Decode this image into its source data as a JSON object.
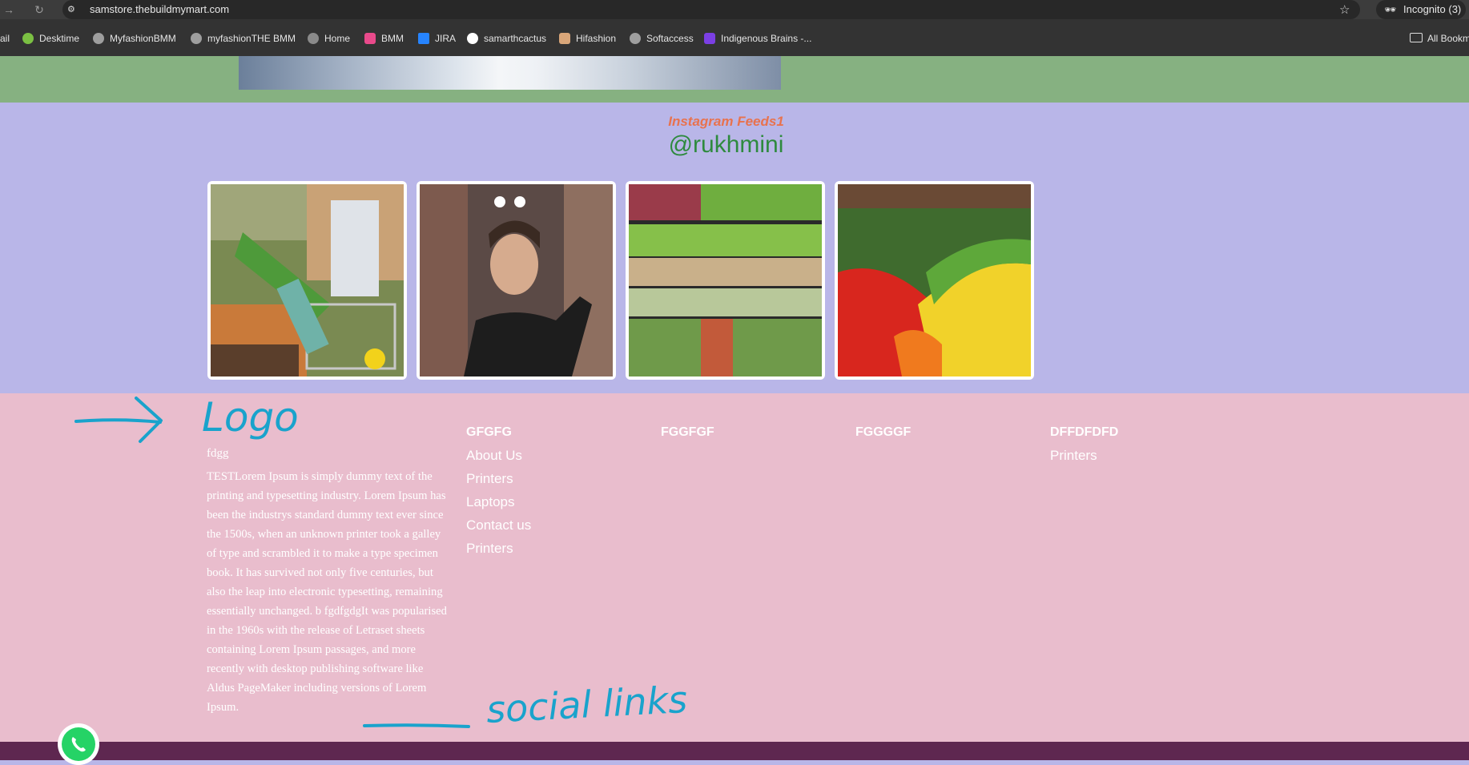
{
  "browser": {
    "url": "samstore.thebuildmymart.com",
    "incognito_label": "Incognito (3)",
    "bookmarks": [
      {
        "label": "ail",
        "color": "#3c3c3c"
      },
      {
        "label": "Desktime",
        "color": "#7bc043"
      },
      {
        "label": "MyfashionBMM",
        "color": "#9e9e9e"
      },
      {
        "label": "myfashionTHE BMM",
        "color": "#9e9e9e"
      },
      {
        "label": "Home",
        "color": "#8a8a8a"
      },
      {
        "label": "BMM",
        "color": "#e94a8b"
      },
      {
        "label": "JIRA",
        "color": "#2684ff"
      },
      {
        "label": "samarthcactus",
        "color": "#ffffff"
      },
      {
        "label": "Hifashion",
        "color": "#d9a679"
      },
      {
        "label": "Softaccess",
        "color": "#9e9e9e"
      },
      {
        "label": "Indigenous Brains -...",
        "color": "#7b3fe4"
      }
    ],
    "all_bookmarks": "All Bookmarks"
  },
  "instagram": {
    "subtitle": "Instagram Feeds1",
    "handle": "@rukhmini",
    "feeds": [
      {
        "label": "grocery basket photo"
      },
      {
        "label": "woman in supermarket photo"
      },
      {
        "label": "vegetable shelves photo"
      },
      {
        "label": "fruit display photo"
      }
    ]
  },
  "footer": {
    "logo_text": "fdgg",
    "description": "TESTLorem Ipsum is simply dummy text of the printing and typesetting industry. Lorem Ipsum has been the industrys standard dummy text ever since the 1500s, when an unknown printer took a galley of type and scrambled it to make a type specimen book. It has survived not only five centuries, but also the leap into electronic typesetting, remaining essentially unchanged. b fgdfgdgIt was popularised in the 1960s with the release of Letraset sheets containing Lorem Ipsum passages, and more recently with desktop publishing software like Aldus PageMaker including versions of Lorem Ipsum.",
    "columns": [
      {
        "heading": "GFGFG",
        "links": [
          "About Us",
          "Printers",
          "Laptops",
          "Contact us",
          "Printers"
        ]
      },
      {
        "heading": "FGGFGF",
        "links": []
      },
      {
        "heading": "FGGGGF",
        "links": []
      },
      {
        "heading": "DFFDFDFD",
        "links": [
          "Printers"
        ]
      }
    ]
  },
  "annotations": {
    "logo": "Logo",
    "social": "social links"
  },
  "colors": {
    "green_band": "#86b181",
    "insta_bg": "#b9b6e8",
    "footer_bg": "#e9bdcd",
    "bottom_bar": "#5e2750",
    "handwriting": "#19a3cc",
    "subtitle": "#e8724e",
    "handle": "#2e8a3e"
  }
}
